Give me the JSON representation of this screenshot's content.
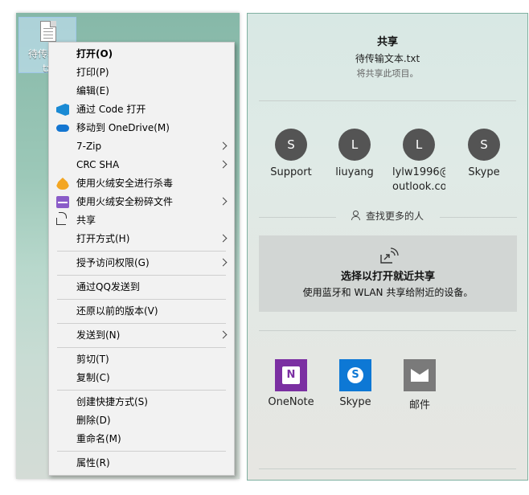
{
  "desktop": {
    "file_label": "待传输文本.txt",
    "file_label_visible_line1": "待传输文",
    "file_label_visible_line2": "tx"
  },
  "context_menu": {
    "groups": [
      [
        {
          "label": "打开(O)",
          "bold": true,
          "icon": "",
          "submenu": false
        },
        {
          "label": "打印(P)",
          "icon": "",
          "submenu": false
        },
        {
          "label": "编辑(E)",
          "icon": "",
          "submenu": false
        },
        {
          "label": "通过 Code 打开",
          "icon": "vscode-icon",
          "submenu": false
        },
        {
          "label": "移动到 OneDrive(M)",
          "icon": "onedrive-icon",
          "submenu": false
        },
        {
          "label": "7-Zip",
          "icon": "",
          "submenu": true
        },
        {
          "label": "CRC SHA",
          "icon": "",
          "submenu": true
        },
        {
          "label": "使用火绒安全进行杀毒",
          "icon": "huorong-antivirus-icon",
          "submenu": false
        },
        {
          "label": "使用火绒安全粉碎文件",
          "icon": "shredder-icon",
          "submenu": true
        },
        {
          "label": "共享",
          "icon": "share-icon",
          "submenu": false
        },
        {
          "label": "打开方式(H)",
          "icon": "",
          "submenu": true
        }
      ],
      [
        {
          "label": "授予访问权限(G)",
          "icon": "",
          "submenu": true
        }
      ],
      [
        {
          "label": "通过QQ发送到",
          "icon": "",
          "submenu": false
        }
      ],
      [
        {
          "label": "还原以前的版本(V)",
          "icon": "",
          "submenu": false
        }
      ],
      [
        {
          "label": "发送到(N)",
          "icon": "",
          "submenu": true
        }
      ],
      [
        {
          "label": "剪切(T)",
          "icon": "",
          "submenu": false
        },
        {
          "label": "复制(C)",
          "icon": "",
          "submenu": false
        }
      ],
      [
        {
          "label": "创建快捷方式(S)",
          "icon": "",
          "submenu": false
        },
        {
          "label": "删除(D)",
          "icon": "",
          "submenu": false
        },
        {
          "label": "重命名(M)",
          "icon": "",
          "submenu": false
        }
      ],
      [
        {
          "label": "属性(R)",
          "icon": "",
          "submenu": false
        }
      ]
    ]
  },
  "share_panel": {
    "title": "共享",
    "file_name": "待传输文本.txt",
    "hint": "将共享此项目。",
    "contacts": [
      {
        "initial": "S",
        "name": "Support"
      },
      {
        "initial": "L",
        "name": "liuyang"
      },
      {
        "initial": "L",
        "name": "lylw1996@\noutlook.co"
      },
      {
        "initial": "S",
        "name": "Skype"
      }
    ],
    "find_more": "查找更多的人",
    "nearby": {
      "title": "选择以打开就近共享",
      "description": "使用蓝牙和 WLAN 共享给附近的设备。"
    },
    "apps": [
      {
        "name": "OneNote",
        "glyph": "N",
        "icon": "onenote-icon",
        "color": "#7b2fa2"
      },
      {
        "name": "Skype",
        "glyph": "S",
        "icon": "skype-icon",
        "color": "#0d78d5"
      },
      {
        "name": "邮件",
        "glyph": "",
        "icon": "mail-icon",
        "color": "#7a7a7a"
      }
    ]
  }
}
